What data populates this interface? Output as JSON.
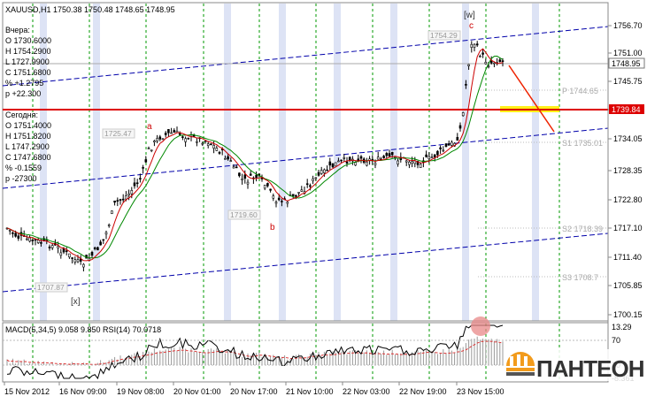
{
  "window": {
    "symbol_title": "XAUUSD,H1  1750.38  1750.48  1748.65  1748.95"
  },
  "yesterday": {
    "title": "Вчера:",
    "open": "O 1730.6000",
    "high": "H 1754.2900",
    "low": "L 1727.9900",
    "close": "C 1751.6800",
    "pct": "% +1.2795",
    "points": "p +22.300"
  },
  "today": {
    "title": "Сегодня:",
    "open": "O 1751.4000",
    "high": "H 1751.8200",
    "low": "L 1747.2900",
    "close": "C 1747.6800",
    "pct": "% -0.1559",
    "points": "p -27300"
  },
  "price_axis": {
    "ticks": [
      "1756.70",
      "1751.00",
      "1745.75",
      "1740.05",
      "1734.05",
      "1728.35",
      "1722.80",
      "1717.10",
      "1711.40",
      "1705.85",
      "1700.15"
    ],
    "current_price": "1748.95",
    "red_line_price": "1739.84"
  },
  "levels": {
    "p": "P 1744.65",
    "s1": "S1 1735.01",
    "s2": "S2 1718.39",
    "s3": "S3 1708.7"
  },
  "chart_labels": {
    "price_1754": "1754.29",
    "price_1725": "1725.47",
    "price_1719": "1719.60",
    "price_1707": "1707.87",
    "wave_a": "a",
    "wave_b": "b",
    "wave_c": "c",
    "wave_w": "[w]",
    "wave_x": "[x]"
  },
  "indicator": {
    "title": "MACD(5,34,5) 9.058 9.850  RSI(14) 70.0718",
    "ticks": [
      "13.29",
      "70",
      "30",
      "-8.361"
    ]
  },
  "time_axis": {
    "labels": [
      "15 Nov 2012",
      "16 Nov 09:00",
      "19 Nov 08:00",
      "20 Nov 01:00",
      "20 Nov 17:00",
      "21 Nov 10:00",
      "22 Nov 03:00",
      "22 Nov 19:00",
      "23 Nov 15:00"
    ]
  },
  "logo": {
    "text": "ПАНТЕОН"
  },
  "colors": {
    "price_line": "#dd0000",
    "channel": "#0000aa",
    "ma_fast": "#cc0000",
    "ma_slow": "#008800",
    "grid_dash": "#009900",
    "session_band": "#dde3f5",
    "highlight": "#ffee00",
    "logo": "#333333",
    "logo_accent": "#f29b1c"
  }
}
